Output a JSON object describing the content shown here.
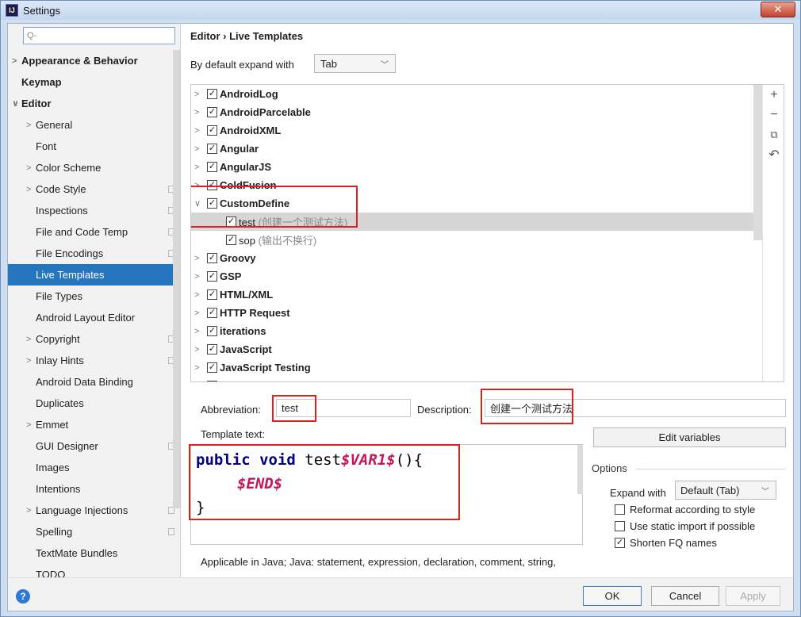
{
  "window": {
    "title": "Settings",
    "logo_text": "IJ",
    "close_glyph": "✕"
  },
  "sidebar": {
    "search_placeholder": "Q-",
    "items": [
      {
        "label": "Appearance & Behavior",
        "arrow": ">",
        "bold": true
      },
      {
        "label": "Keymap",
        "arrow": "",
        "bold": true
      },
      {
        "label": "Editor",
        "arrow": "∨",
        "bold": true
      },
      {
        "label": "General",
        "arrow": ">"
      },
      {
        "label": "Font",
        "arrow": ""
      },
      {
        "label": "Color Scheme",
        "arrow": ">"
      },
      {
        "label": "Code Style",
        "arrow": ">"
      },
      {
        "label": "Inspections",
        "arrow": ""
      },
      {
        "label": "File and Code Temp",
        "arrow": ""
      },
      {
        "label": "File Encodings",
        "arrow": ""
      },
      {
        "label": "Live Templates",
        "arrow": "",
        "selected": true
      },
      {
        "label": "File Types",
        "arrow": ""
      },
      {
        "label": "Android Layout Editor",
        "arrow": ""
      },
      {
        "label": "Copyright",
        "arrow": ">"
      },
      {
        "label": "Inlay Hints",
        "arrow": ">"
      },
      {
        "label": "Android Data Binding",
        "arrow": ""
      },
      {
        "label": "Duplicates",
        "arrow": ""
      },
      {
        "label": "Emmet",
        "arrow": ">"
      },
      {
        "label": "GUI Designer",
        "arrow": ""
      },
      {
        "label": "Images",
        "arrow": ""
      },
      {
        "label": "Intentions",
        "arrow": ""
      },
      {
        "label": "Language Injections",
        "arrow": ">"
      },
      {
        "label": "Spelling",
        "arrow": ""
      },
      {
        "label": "TextMate Bundles",
        "arrow": ""
      },
      {
        "label": "TODO",
        "arrow": ""
      }
    ]
  },
  "main": {
    "breadcrumb": "Editor  ›  Live Templates",
    "expand_label": "By default expand with",
    "expand_value": "Tab",
    "templates": [
      {
        "name": "AndroidLog",
        "arrow": ">",
        "checked": true
      },
      {
        "name": "AndroidParcelable",
        "arrow": ">",
        "checked": true
      },
      {
        "name": "AndroidXML",
        "arrow": ">",
        "checked": true
      },
      {
        "name": "Angular",
        "arrow": ">",
        "checked": true
      },
      {
        "name": "AngularJS",
        "arrow": ">",
        "checked": true
      },
      {
        "name": "ColdFusion",
        "arrow": ">",
        "checked": true
      },
      {
        "name": "CustomDefine",
        "arrow": "∨",
        "checked": true
      },
      {
        "name": "test",
        "desc": " (创建一个测试方法)",
        "child": true,
        "checked": true,
        "highlight": true
      },
      {
        "name": "sop",
        "desc": " (输出不换行)",
        "child": true,
        "checked": true
      },
      {
        "name": "Groovy",
        "arrow": ">",
        "checked": true
      },
      {
        "name": "GSP",
        "arrow": ">",
        "checked": true
      },
      {
        "name": "HTML/XML",
        "arrow": ">",
        "checked": true
      },
      {
        "name": "HTTP Request",
        "arrow": ">",
        "checked": true
      },
      {
        "name": "iterations",
        "arrow": ">",
        "checked": true
      },
      {
        "name": "JavaScript",
        "arrow": ">",
        "checked": true
      },
      {
        "name": "JavaScript Testing",
        "arrow": ">",
        "checked": true
      },
      {
        "name": "JSP",
        "arrow": ">",
        "checked": true
      }
    ],
    "toolbar": {
      "add": "+",
      "remove": "−",
      "copy": "⧉",
      "restore": "↶"
    },
    "abbreviation_label": "Abbreviation:",
    "abbreviation_value": "test",
    "description_label": "Description:",
    "description_value": "创建一个测试方法",
    "template_text_label": "Template text:",
    "code": {
      "line1_kw": "public void ",
      "line1_name": "test",
      "line1_var": "$VAR1$",
      "line1_tail": "(){",
      "line2_var": "$END$",
      "line3": "}"
    },
    "edit_variables": "Edit variables",
    "options_label": "Options",
    "expand_with_label": "Expand with",
    "expand_with_value": "Default (Tab)",
    "options": [
      {
        "label": "Reformat according to style",
        "checked": false
      },
      {
        "label": "Use static import if possible",
        "checked": false
      },
      {
        "label": "Shorten FQ names",
        "checked": true
      }
    ],
    "applicable": "Applicable in Java; Java: statement, expression, declaration, comment, string,"
  },
  "footer": {
    "help": "?",
    "ok": "OK",
    "cancel": "Cancel",
    "apply": "Apply"
  }
}
